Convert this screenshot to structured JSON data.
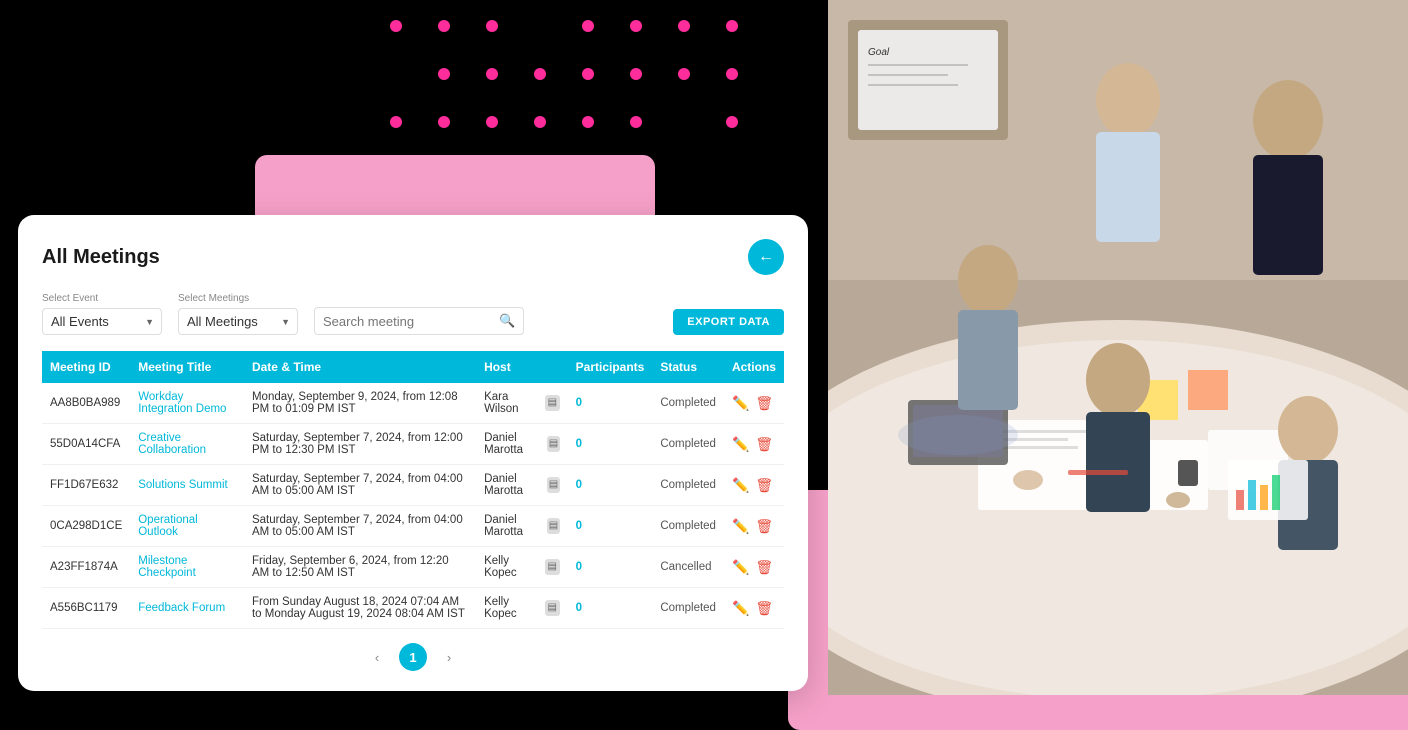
{
  "page": {
    "title": "All Meetings",
    "background_color": "#000000",
    "accent_color": "#00b8d9",
    "pink_color": "#f5a0c8",
    "dot_color": "#ff2d9b"
  },
  "filters": {
    "select_event_label": "Select Event",
    "select_event_value": "All Events",
    "select_meetings_label": "Select Meetings",
    "select_meetings_value": "All Meetings",
    "search_placeholder": "Search meeting",
    "export_button_label": "EXPORT DATA"
  },
  "back_button_label": "←",
  "table": {
    "columns": [
      "Meeting ID",
      "Meeting Title",
      "Date & Time",
      "Host",
      "Participants",
      "Status",
      "Actions"
    ],
    "rows": [
      {
        "id": "AA8B0BA989",
        "title": "Workday Integration Demo",
        "datetime": "Monday, September 9, 2024, from 12:08 PM to 01:09 PM IST",
        "host": "Kara Wilson",
        "participants": "0",
        "status": "Completed"
      },
      {
        "id": "55D0A14CFA",
        "title": "Creative Collaboration",
        "datetime": "Saturday, September 7, 2024, from 12:00 PM to 12:30 PM IST",
        "host": "Daniel Marotta",
        "participants": "0",
        "status": "Completed"
      },
      {
        "id": "FF1D67E632",
        "title": "Solutions Summit",
        "datetime": "Saturday, September 7, 2024, from 04:00 AM to 05:00 AM IST",
        "host": "Daniel Marotta",
        "participants": "0",
        "status": "Completed"
      },
      {
        "id": "0CA298D1CE",
        "title": "Operational Outlook",
        "datetime": "Saturday, September 7, 2024, from 04:00 AM to 05:00 AM IST",
        "host": "Daniel Marotta",
        "participants": "0",
        "status": "Completed"
      },
      {
        "id": "A23FF1874A",
        "title": "Milestone Checkpoint",
        "datetime": "Friday, September 6, 2024, from 12:20 AM to 12:50 AM IST",
        "host": "Kelly Kopec",
        "participants": "0",
        "status": "Cancelled"
      },
      {
        "id": "A556BC1179",
        "title": "Feedback Forum",
        "datetime": "From Sunday August 18, 2024 07:04 AM to Monday August 19, 2024 08:04 AM IST",
        "host": "Kelly Kopec",
        "participants": "0",
        "status": "Completed"
      }
    ]
  },
  "pagination": {
    "current_page": 1,
    "prev_label": "‹",
    "next_label": "›"
  }
}
